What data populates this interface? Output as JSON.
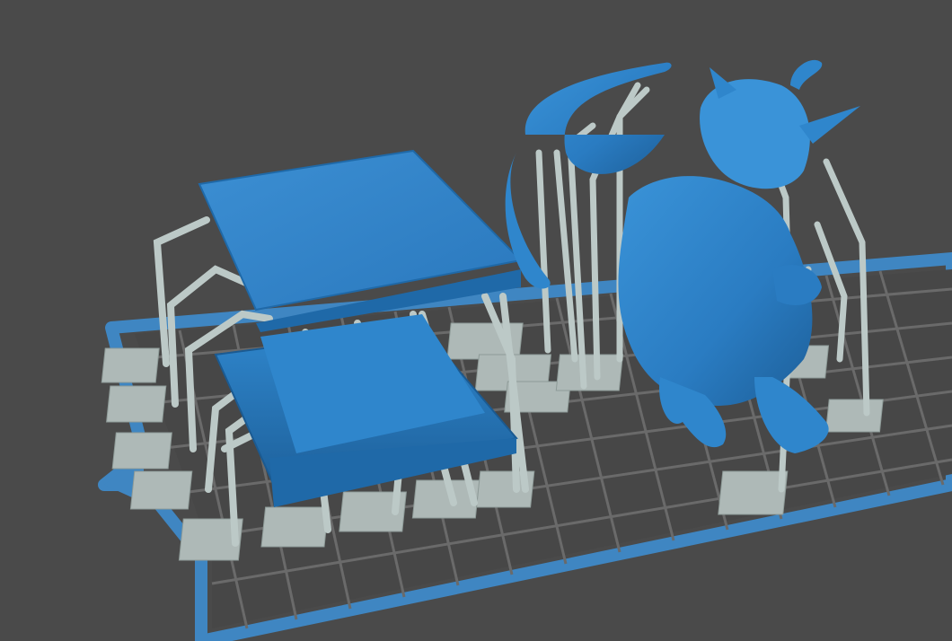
{
  "viewport": {
    "background": "#4a4a4a",
    "build_plate_color": "#3f86c2",
    "grid_color": "#6a6a6a",
    "model_color": "#2f86cc",
    "support_color": "#bcc9c7",
    "raft_color": "#aeb9b7"
  },
  "objects": [
    {
      "name": "pedestal-model",
      "icon": "pedestal"
    },
    {
      "name": "gargoyle-model",
      "icon": "gargoyle"
    }
  ]
}
